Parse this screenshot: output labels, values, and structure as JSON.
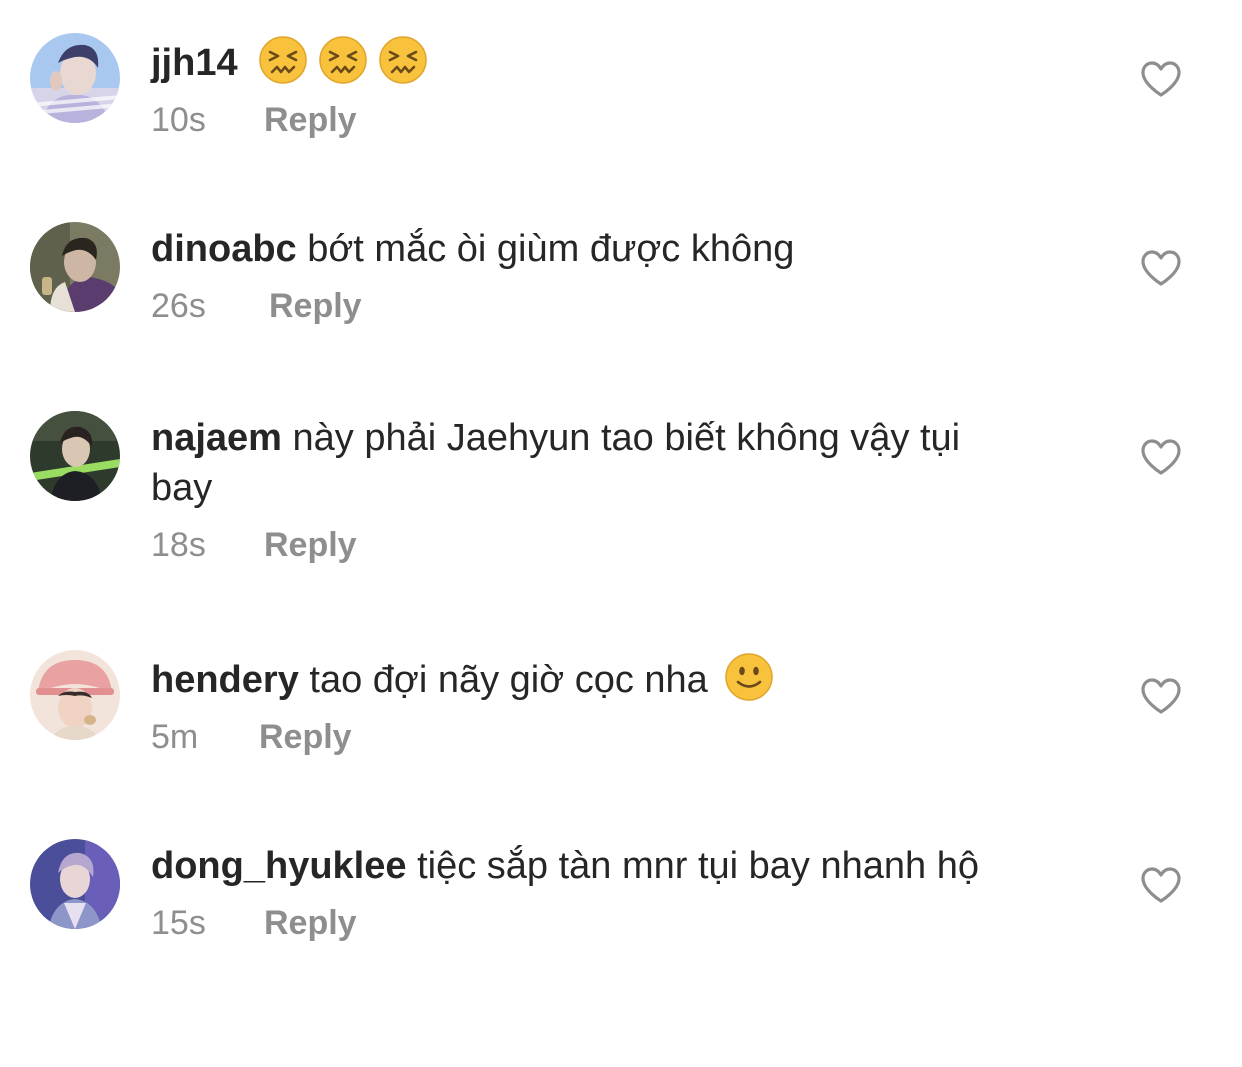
{
  "comments": [
    {
      "username": "jjh14",
      "text": "",
      "emojis": [
        "confounded-face-emoji",
        "confounded-face-emoji",
        "confounded-face-emoji"
      ],
      "time": "10s",
      "reply_label": "Reply",
      "avatar_colors": [
        "#a9c8ef",
        "#e9d8d2",
        "#3c3f6a"
      ]
    },
    {
      "username": "dinoabc",
      "text": "bớt mắc òi giùm được không",
      "emojis": [],
      "time": "26s",
      "reply_label": "Reply",
      "avatar_colors": [
        "#7b7a63",
        "#cdb7a4",
        "#5a3d6e"
      ]
    },
    {
      "username": "najaem",
      "text": "này phải Jaehyun tao biết không vậy tụi bay",
      "emojis": [],
      "time": "18s",
      "reply_label": "Reply",
      "avatar_colors": [
        "#2e3a2c",
        "#d9c6b3",
        "#9adb62"
      ]
    },
    {
      "username": "hendery",
      "text": "tao đợi nãy giờ cọc nha",
      "emojis": [
        "slightly-smiling-face-emoji"
      ],
      "time": "5m",
      "reply_label": "Reply",
      "avatar_colors": [
        "#e9a1a2",
        "#f0d3c3",
        "#3a2c2a"
      ]
    },
    {
      "username": "dong_hyuklee",
      "text": "tiệc sắp tàn mnr tụi bay nhanh hộ",
      "emojis": [],
      "time": "15s",
      "reply_label": "Reply",
      "avatar_colors": [
        "#4b4f9a",
        "#e8d6d6",
        "#8d96c8"
      ]
    }
  ],
  "colors": {
    "text_primary": "#262626",
    "text_secondary": "#8e8e8e",
    "heart_outline": "#8e8e8e",
    "emoji_yellow": "#f9c23c"
  }
}
